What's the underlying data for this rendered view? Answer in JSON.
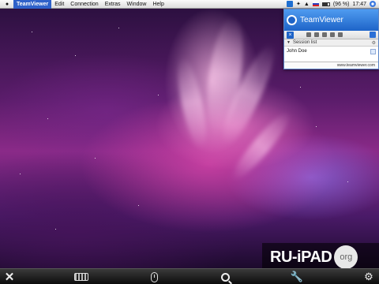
{
  "menubar": {
    "app_name": "TeamViewer",
    "menus": [
      "Edit",
      "Connection",
      "Extras",
      "Window",
      "Help"
    ],
    "battery": "(96 %)",
    "time": "17:47"
  },
  "teamviewer_panel": {
    "brand": "TeamViewer",
    "session_list_label": "Session list",
    "sessions": [
      "John Doe"
    ],
    "footer_link": "www.teamviewer.com"
  },
  "watermark": {
    "text": "RU-iPAD",
    "badge": "org"
  },
  "bottom_toolbar": {
    "icons": [
      "close-icon",
      "keyboard-icon",
      "mouse-icon",
      "zoom-icon",
      "wrench-icon",
      "gear-icon"
    ]
  }
}
